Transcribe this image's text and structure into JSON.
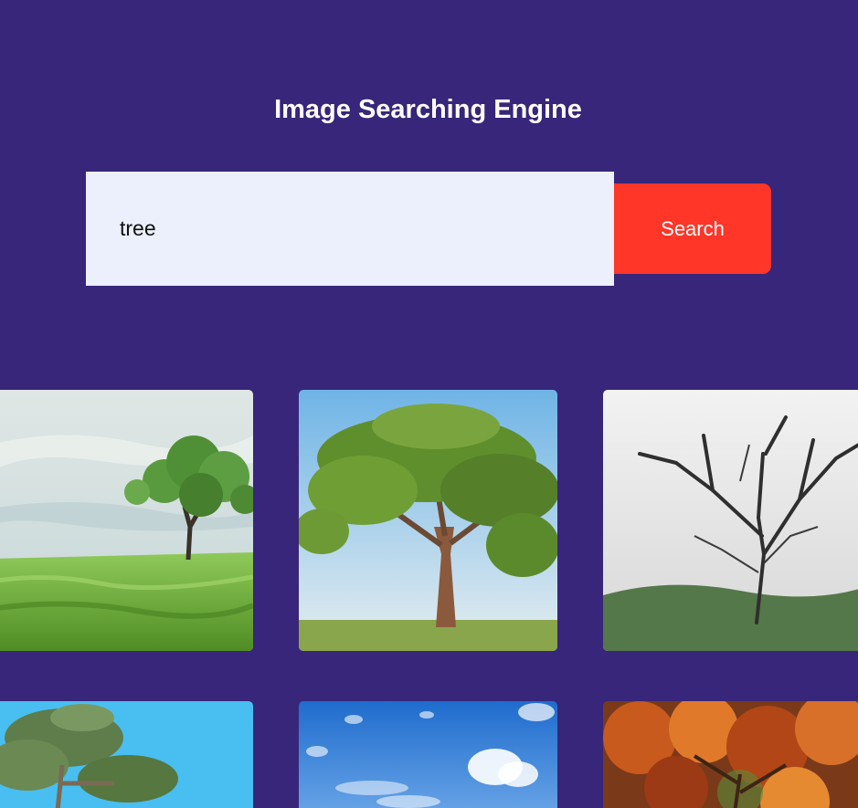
{
  "header": {
    "title": "Image Searching Engine"
  },
  "search": {
    "value": "tree",
    "button_label": "Search"
  },
  "results": [
    {
      "subject": "lone tree on green grass field"
    },
    {
      "subject": "large tree under blue sky"
    },
    {
      "subject": "bare tree in fog"
    },
    {
      "subject": "tree against bright blue sky"
    },
    {
      "subject": "blue sky with clouds"
    },
    {
      "subject": "autumn tree with orange leaves"
    }
  ],
  "colors": {
    "background": "#38267a",
    "input_background": "#ebf0fc",
    "button": "#ff3628",
    "title_text": "#ffffff"
  }
}
